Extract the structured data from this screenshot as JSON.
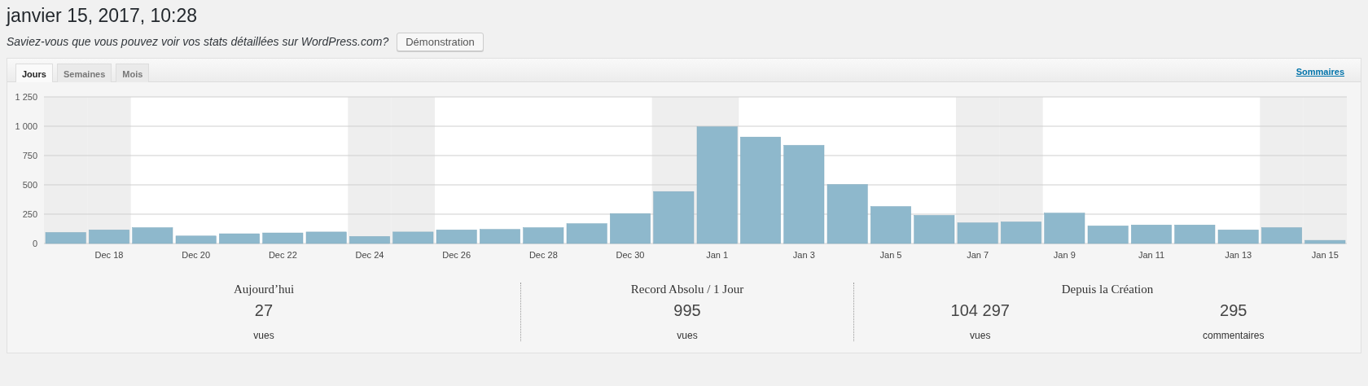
{
  "header": {
    "title": "janvier 15, 2017, 10:28",
    "notice": "Saviez-vous que vous pouvez voir vos stats détaillées sur WordPress.com?",
    "demo_button": "Démonstration"
  },
  "panel": {
    "tabs": [
      {
        "label": "Jours",
        "selected": true
      },
      {
        "label": "Semaines",
        "selected": false
      },
      {
        "label": "Mois",
        "selected": false
      }
    ],
    "summary_link": "Sommaires",
    "chart_data": {
      "type": "bar",
      "ylim": [
        0,
        1250
      ],
      "grid": true,
      "categories": [
        null,
        "Dec 18",
        null,
        "Dec 20",
        null,
        "Dec 22",
        null,
        "Dec 24",
        null,
        "Dec 26",
        null,
        "Dec 28",
        null,
        "Dec 30",
        null,
        "Jan 1",
        null,
        "Jan 3",
        null,
        "Jan 5",
        null,
        "Jan 7",
        null,
        "Jan 9",
        null,
        "Jan 11",
        null,
        "Jan 13",
        null,
        "Jan 15"
      ],
      "yticks": [
        0,
        {
          "value": 250,
          "label": "250"
        },
        {
          "value": 500,
          "label": "500"
        },
        {
          "value": 750,
          "label": "750"
        },
        {
          "value": 1000,
          "label": "1 000"
        },
        {
          "value": 1250,
          "label": "1 250"
        }
      ],
      "series": [
        {
          "color": "#8eb8cc",
          "values": [
            94,
            116,
            135,
            64,
            83,
            90,
            98,
            60,
            98,
            116,
            120,
            135,
            169,
            255,
            443,
            995,
            908,
            837,
            503,
            315,
            240,
            176,
            184,
            259,
            150,
            158,
            158,
            116,
            135,
            27
          ]
        }
      ]
    }
  },
  "stats": [
    {
      "title": "Aujourd’hui",
      "items": [
        {
          "value": "27",
          "label": "vues"
        }
      ]
    },
    {
      "title": "Record Absolu / 1 Jour",
      "items": [
        {
          "value": "995",
          "label": "vues"
        }
      ]
    },
    {
      "title": "Depuis la Création",
      "items": [
        {
          "value": "104 297",
          "label": "vues"
        },
        {
          "value": "295",
          "label": "commentaires"
        }
      ]
    }
  ]
}
